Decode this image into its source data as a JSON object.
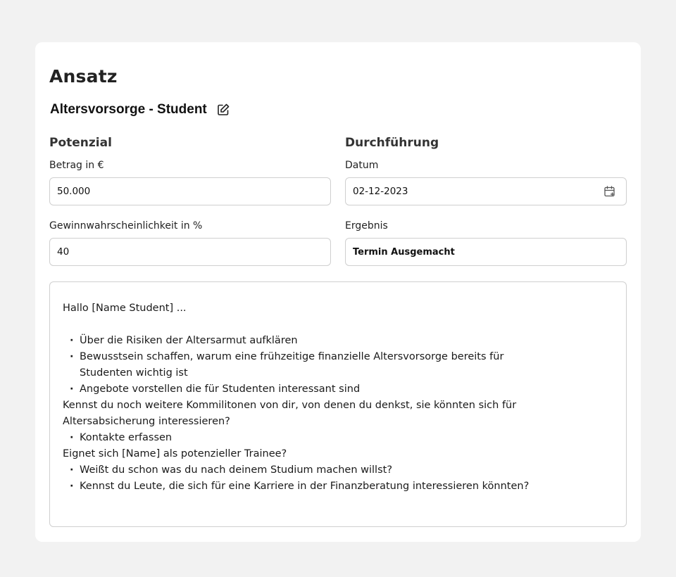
{
  "page": {
    "title": "Ansatz"
  },
  "approach": {
    "title": "Altersvorsorge - Student"
  },
  "potential": {
    "section_title": "Potenzial",
    "amount_label": "Betrag in €",
    "amount_value": "50.000",
    "probability_label": "Gewinnwahrscheinlichkeit in %",
    "probability_value": "40"
  },
  "execution": {
    "section_title": "Durchführung",
    "date_label": "Datum",
    "date_value": "02-12-2023",
    "result_label": "Ergebnis",
    "result_value": "Termin Ausgemacht"
  },
  "notes": {
    "greeting": "Hallo [Name Student] ...",
    "bullets_1": [
      "Über die Risiken der Altersarmut aufklären",
      "Bewusstsein schaffen, warum eine frühzeitige finanzielle Altersvorsorge bereits für Studenten wichtig ist",
      "Angebote vorstellen die für Studenten interessant sind"
    ],
    "question_1_line1": "Kennst du noch weitere Kommilitonen von dir, von denen du denkst, sie könnten sich für",
    "question_1_line2": "Altersabsicherung interessieren?",
    "bullets_2": [
      "Kontakte erfassen"
    ],
    "question_2": "Eignet sich [Name] als potenzieller Trainee?",
    "bullets_3": [
      "Weißt du schon was du nach deinem Studium machen willst?",
      "Kennst du Leute, die sich für eine Karriere in der Finanzberatung interessieren könnten?"
    ]
  }
}
